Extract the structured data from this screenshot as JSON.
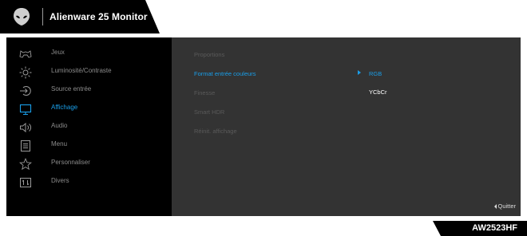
{
  "header": {
    "title": "Alienware 25 Monitor",
    "logo_icon": "alien-head-icon"
  },
  "colors": {
    "accent": "#1a9ee8",
    "panel": "#333333",
    "sidebar": "#000000",
    "header": "#000000"
  },
  "menu": {
    "items": [
      {
        "label": "Jeux",
        "icon": "gamepad-icon"
      },
      {
        "label": "Luminosité/Contraste",
        "icon": "brightness-icon"
      },
      {
        "label": "Source entrée",
        "icon": "input-source-icon"
      },
      {
        "label": "Affichage",
        "icon": "display-icon",
        "active": true
      },
      {
        "label": "Audio",
        "icon": "speaker-icon"
      },
      {
        "label": "Menu",
        "icon": "menu-icon"
      },
      {
        "label": "Personnaliser",
        "icon": "star-icon"
      },
      {
        "label": "Divers",
        "icon": "other-icon"
      }
    ]
  },
  "submenu": {
    "items": [
      {
        "label": "Proportions"
      },
      {
        "label": "Format entrée couleurs",
        "selected": true
      },
      {
        "label": "Finesse"
      },
      {
        "label": "Smart HDR"
      },
      {
        "label": "Réinit. affichage"
      }
    ]
  },
  "options": {
    "items": [
      {
        "label": "RGB",
        "selected": true
      },
      {
        "label": "YCbCr"
      }
    ]
  },
  "footer": {
    "quit_label": "Quitter",
    "model": "AW2523HF"
  }
}
